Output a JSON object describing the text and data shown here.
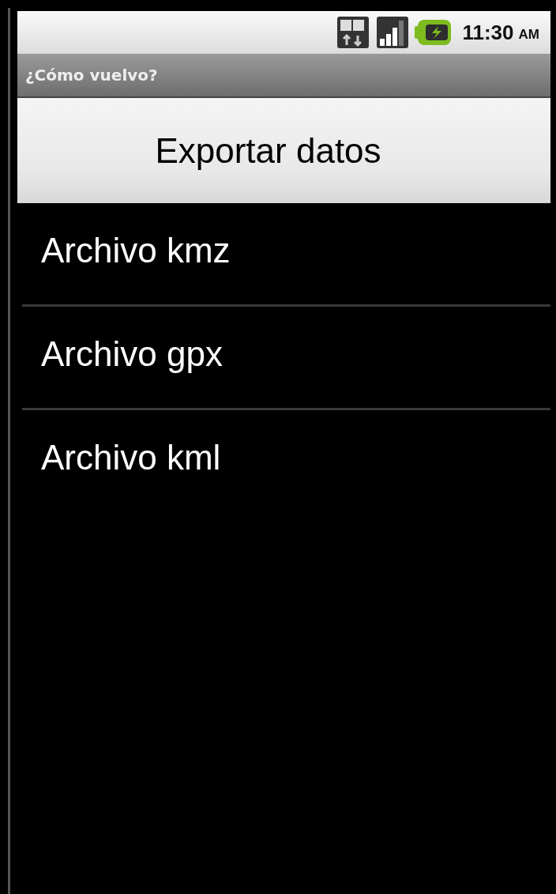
{
  "status_bar": {
    "time": "11:30",
    "period": "AM"
  },
  "window": {
    "title": "¿Cómo vuelvo?"
  },
  "header": {
    "title": "Exportar datos"
  },
  "items": [
    {
      "label": "Archivo kmz"
    },
    {
      "label": "Archivo gpx"
    },
    {
      "label": "Archivo kml"
    }
  ]
}
